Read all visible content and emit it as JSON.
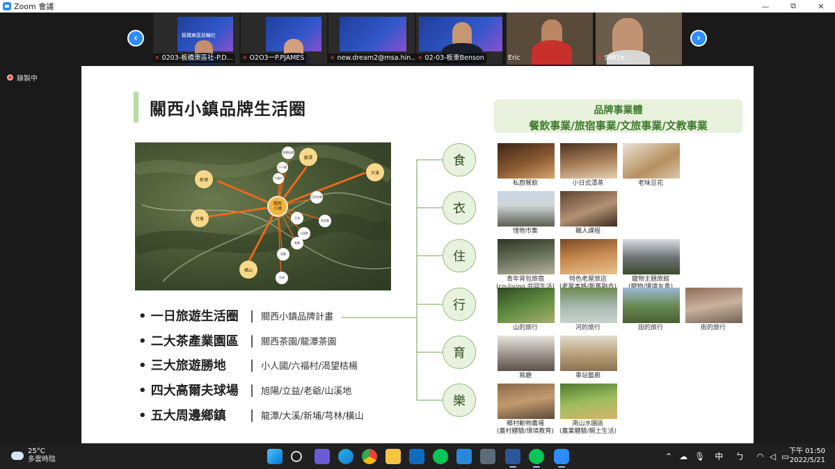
{
  "window": {
    "title": "Zoom 會議",
    "minimize": "—",
    "maximize": "⧉",
    "close": "✕"
  },
  "video_strip": {
    "prev": "‹",
    "next": "›",
    "participants": [
      {
        "name": "0203-板橋東區社-P.D..."
      },
      {
        "name": "O2O3一P.PJAMES"
      },
      {
        "name": "new.dream2@msa.hin..."
      },
      {
        "name": "02-03-板東Benson"
      },
      {
        "name": "Eric"
      },
      {
        "name": "SMI1e"
      }
    ],
    "banner_text": "板橋東區扶輪社"
  },
  "recording": {
    "label": "錄製中"
  },
  "slide": {
    "title": "關西小鎮品牌生活圈",
    "brand_heading": "品牌事業體",
    "brand_list": "餐飲事業/旅宿事業/文旅事業/文教事業",
    "map": {
      "center": "關西\n小鎮",
      "nodes": [
        {
          "label": "新埔"
        },
        {
          "label": "龍潭"
        },
        {
          "label": "大溪"
        },
        {
          "label": "竹東"
        },
        {
          "label": "橫山"
        },
        {
          "label": "渴望桔楊"
        },
        {
          "label": "小人國"
        },
        {
          "label": "六福村"
        },
        {
          "label": "石門水庫"
        },
        {
          "label": "馬武督"
        },
        {
          "label": "山溪地"
        },
        {
          "label": "老爺"
        },
        {
          "label": "立益"
        },
        {
          "label": "旭陽"
        },
        {
          "label": "內灣"
        }
      ]
    },
    "bullets": [
      {
        "main": "• 一日旅遊生活圈",
        "sep": "|",
        "sub": "關西小鎮品牌計畫"
      },
      {
        "main": "• 二大茶產業園區",
        "sep": "|",
        "sub": "關西茶園/龍潭茶園"
      },
      {
        "main": "• 三大旅遊勝地",
        "sep": "|",
        "sub": "小人國/六福村/渴望桔楊"
      },
      {
        "main": "• 四大高爾夫球場",
        "sep": "|",
        "sub": "旭陽/立益/老爺/山溪地"
      },
      {
        "main": "• 五大周邊鄉鎮",
        "sep": "|",
        "sub": "龍潭/大溪/新埔/芎林/橫山"
      }
    ],
    "categories": [
      {
        "name": "食",
        "items": [
          {
            "caption": "私廚餐飲"
          },
          {
            "caption": "小日式漬茶"
          },
          {
            "caption": "老味豆花"
          }
        ]
      },
      {
        "name": "衣",
        "items": [
          {
            "caption": "惜物市集"
          },
          {
            "caption": "職人課程"
          }
        ]
      },
      {
        "name": "住",
        "items": [
          {
            "caption": "青年背包旅宿\n(co-living 共同生活)"
          },
          {
            "caption": "特色老屋旅店\n(老屋本格/新舊融合)"
          },
          {
            "caption": "寵物主題旅館\n(寵物/環境友善)"
          }
        ]
      },
      {
        "name": "行",
        "items": [
          {
            "caption": "山的旅行"
          },
          {
            "caption": "河的旅行"
          },
          {
            "caption": "田的旅行"
          },
          {
            "caption": "街的旅行"
          }
        ]
      },
      {
        "name": "育",
        "items": [
          {
            "caption": "窩廳"
          },
          {
            "caption": "車站藝廊"
          }
        ]
      },
      {
        "name": "樂",
        "items": [
          {
            "caption": "鄉村動物農場\n(農村體驗/環境教育)"
          },
          {
            "caption": "南山水園區\n(農業體驗/親土生活)"
          }
        ]
      }
    ]
  },
  "taskbar": {
    "weather": {
      "temp": "25°C",
      "condition": "多雲時陰"
    },
    "ime": "中",
    "ime2": "ㄅ",
    "clock": {
      "time": "下午 01:50",
      "date": "2022/5/21"
    },
    "colors": {
      "accent": "#2d8cff",
      "record": "#e8443a"
    }
  }
}
